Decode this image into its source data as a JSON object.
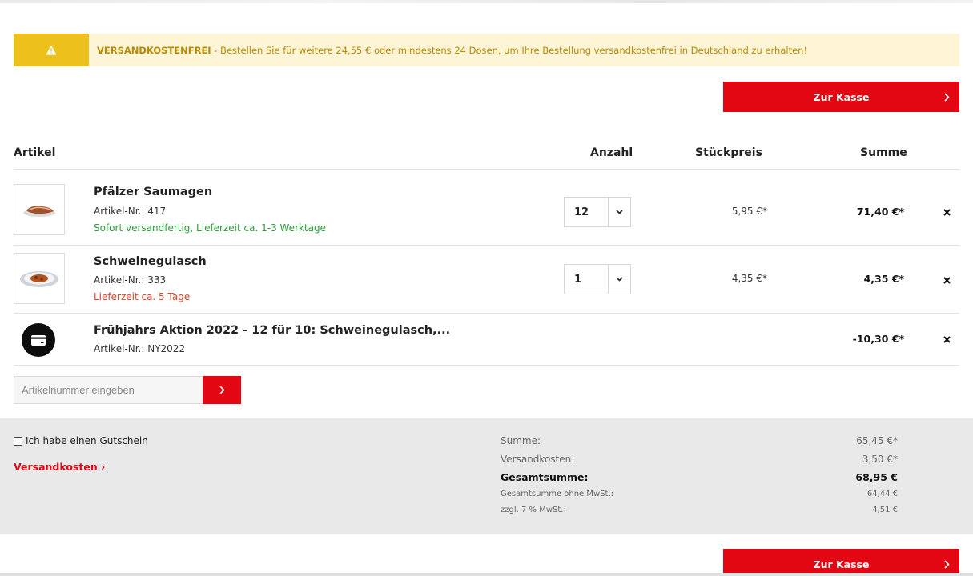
{
  "notice": {
    "strong": "VERSANDKOSTENFREI",
    "text": " - Bestellen Sie für weitere 24,55 € oder mindestens 24 Dosen, um Ihre Bestellung versandkostenfrei in Deutschland zu erhalten!",
    "icon": "warning-icon",
    "bg_color": "#fdf5d6",
    "icon_bg_color": "#edc01b"
  },
  "checkout_label": "Zur Kasse",
  "accent_color": "#e30613",
  "table": {
    "headers": {
      "article": "Artikel",
      "quantity": "Anzahl",
      "unit_price": "Stückpreis",
      "total": "Summe"
    },
    "rows": [
      {
        "name": "Pfälzer Saumagen",
        "number": "Artikel-Nr.: 417",
        "delivery": "Sofort versandfertig, Lieferzeit ca. 1-3 Werktage",
        "quantity": "12",
        "unit_price": "5,95 €*",
        "total": "71,40 €*"
      },
      {
        "name": "Schweinegulasch",
        "number": "Artikel-Nr.: 333",
        "delivery": "Lieferzeit ca. 5 Tage",
        "quantity": "1",
        "unit_price": "4,35 €*",
        "total": "4,35 €*"
      },
      {
        "name": "Frühjahrs Aktion 2022 - 12 für 10: Schweinegulasch,...",
        "number": "Artikel-Nr.: NY2022",
        "total": "-10,30 €*",
        "icon": "voucher-card-icon"
      }
    ]
  },
  "article_search": {
    "placeholder": "Artikelnummer eingeben"
  },
  "summary": {
    "voucher_label": "Ich habe einen Gutschein",
    "shipping_link": "Versandkosten ›",
    "lines": [
      {
        "label": "Summe:",
        "value": "65,45 €*"
      },
      {
        "label": "Versandkosten:",
        "value": "3,50 €*"
      },
      {
        "label": "Gesamtsumme:",
        "value": "68,95 €"
      },
      {
        "label": "Gesamtsumme ohne MwSt.:",
        "value": "64,44 €"
      },
      {
        "label": "zzgl. 7 % MwSt.:",
        "value": "4,51 €"
      }
    ]
  }
}
